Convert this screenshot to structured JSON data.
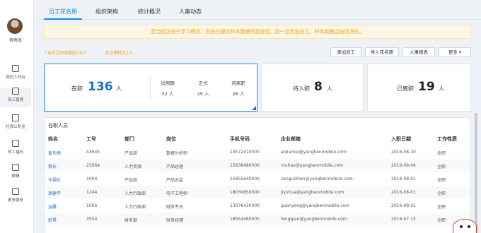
{
  "user": {
    "name": "蔡春鑫"
  },
  "nav": [
    {
      "label": "我的工作台",
      "icon": "monitor-icon"
    },
    {
      "label": "员工管理",
      "icon": "id-card-icon"
    },
    {
      "label": "社保公积金",
      "icon": "house-icon"
    },
    {
      "label": "员工福利",
      "icon": "gift-icon"
    },
    {
      "label": "薪酬",
      "icon": "briefcase-icon"
    },
    {
      "label": "更多服务",
      "icon": "grid-icon"
    }
  ],
  "tabs": [
    "员工花名册",
    "组织架构",
    "统计概况",
    "人事动态"
  ],
  "notice": "您当前正处于学习模式，系统已提供样本数据供您体验。您一旦添加员工，样本数据会自动消失。",
  "warnings": [
    "* 本月合同到期的16人",
    "本月需转正2人"
  ],
  "toolbar": {
    "add": "添加员工",
    "import": "导入花名册",
    "report": "人事报表",
    "more": "更多 ▾"
  },
  "stats": {
    "onjob_label": "在职",
    "onjob_count": "136",
    "unit": "人",
    "probation_label": "试用期",
    "probation": "32 人",
    "formal_label": "正式",
    "formal": "29 人",
    "leaving_label": "待离职",
    "leaving": "26 人",
    "pending_label": "待入职",
    "pending_count": "8",
    "left_label": "已离职",
    "left_count": "19"
  },
  "table": {
    "title": "在职人员",
    "headers": [
      "姓名",
      "工号",
      "部门",
      "岗位",
      "手机号码",
      "企业邮箱",
      "入职日期",
      "工作性质"
    ],
    "rows": [
      [
        "爱东梅",
        "43645",
        "产品部",
        "数据分析师",
        "13572410000",
        "aixiumei@yangbenmobile.com",
        "2016-08-10",
        "全职"
      ],
      [
        "穆东",
        "25664",
        "人力资源",
        "产品经理",
        "15838480000",
        "muhao@yangbenmobile.com",
        "2016-08-04",
        "全职"
      ],
      [
        "岑福珍",
        "1004",
        "产品部",
        "产品总监",
        "15955640000",
        "cenguizhen@yangbenmobile.com",
        "2016-08-01",
        "全职"
      ],
      [
        "单建平",
        "1244",
        "人力行政部",
        "电子工程师",
        "18030850000",
        "jiyuhua@yangbenmobile.com",
        "2016-08-01",
        "全职"
      ],
      [
        "温晨",
        "1006",
        "人力行政部",
        "财务专员",
        "13076430000",
        "guanyong@yangbenmobile.com",
        "2016-08-01",
        "全职"
      ],
      [
        "彭琴",
        "3554",
        "财务部",
        "财务经理",
        "18554460000",
        "fengqian@yangbenmobile.com",
        "2016-07-15",
        "全职"
      ]
    ]
  }
}
